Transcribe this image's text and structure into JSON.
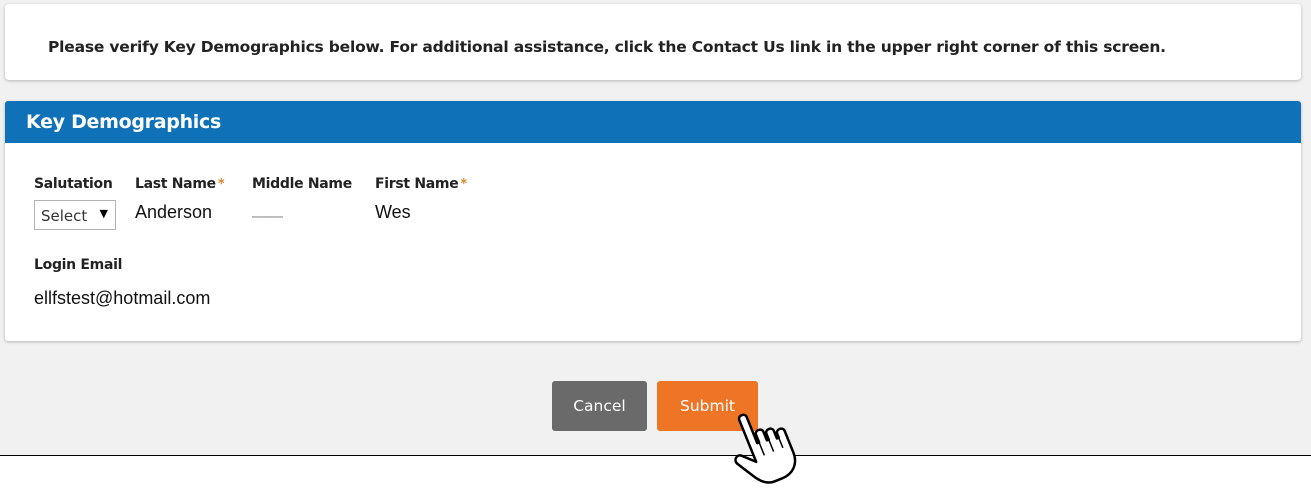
{
  "notice": {
    "text": "Please verify Key Demographics below. For additional assistance, click the Contact Us link in the upper right corner of this screen."
  },
  "section": {
    "title": "Key Demographics"
  },
  "fields": {
    "salutation": {
      "label": "Salutation",
      "value": "Select",
      "arrow": "▼"
    },
    "last_name": {
      "label": "Last Name",
      "required_mark": "*",
      "value": "Anderson"
    },
    "middle_name": {
      "label": "Middle Name",
      "value": "——"
    },
    "first_name": {
      "label": "First Name",
      "required_mark": "*",
      "value": "Wes"
    },
    "login_email": {
      "label": "Login Email",
      "value": "ellfstest@hotmail.com"
    }
  },
  "buttons": {
    "cancel": "Cancel",
    "submit": "Submit"
  },
  "colors": {
    "header_blue": "#0f72b8",
    "submit_orange": "#ef7526",
    "cancel_gray": "#6a6a6a",
    "required_star": "#d8872b"
  },
  "icons": {
    "cursor": "hand-pointer-icon"
  }
}
